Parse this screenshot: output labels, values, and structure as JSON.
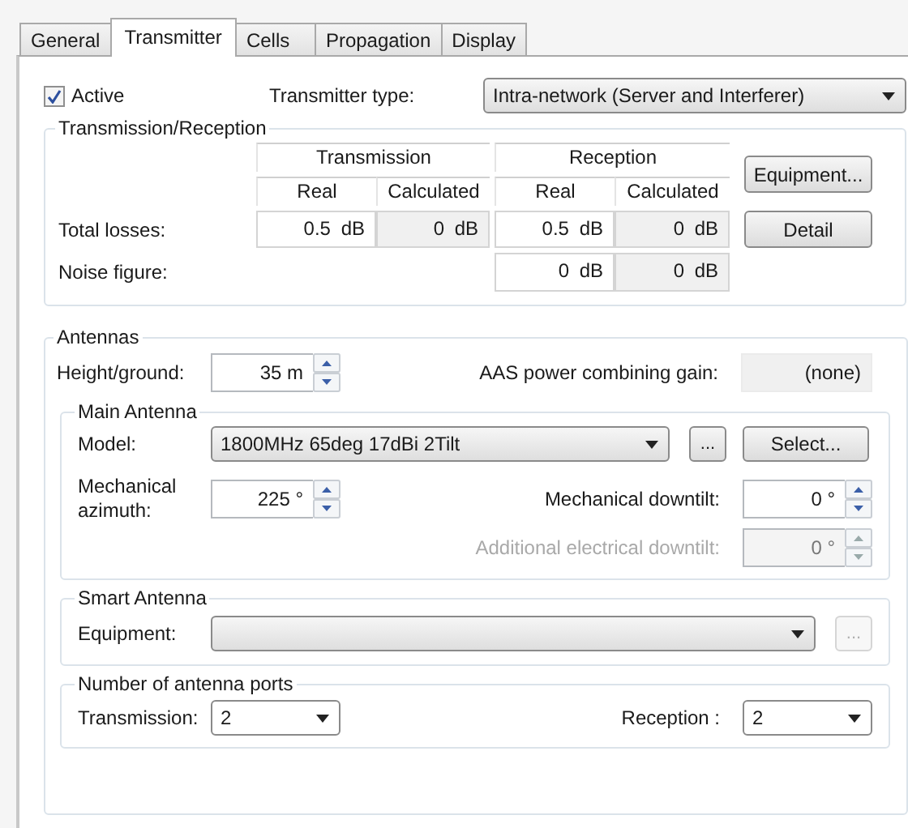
{
  "tabs": [
    {
      "label": "General",
      "selected": false
    },
    {
      "label": "Transmitter",
      "selected": true
    },
    {
      "label": "Cells",
      "selected": false
    },
    {
      "label": "Propagation",
      "selected": false
    },
    {
      "label": "Display",
      "selected": false
    }
  ],
  "active": {
    "label": "Active",
    "checked": true
  },
  "transmitter_type": {
    "label": "Transmitter type:",
    "value": "Intra-network (Server and Interferer)"
  },
  "transmission_reception": {
    "title": "Transmission/Reception",
    "column_groups": [
      {
        "title": "Transmission",
        "columns": [
          {
            "label": "Real",
            "readonly": false
          },
          {
            "label": "Calculated",
            "readonly": true
          }
        ]
      },
      {
        "title": "Reception",
        "columns": [
          {
            "label": "Real",
            "readonly": false
          },
          {
            "label": "Calculated",
            "readonly": true
          }
        ]
      }
    ],
    "rows": [
      {
        "label": "Total losses:",
        "cells": [
          "0.5 dB",
          "0 dB",
          "0.5 dB",
          "0 dB"
        ]
      },
      {
        "label": "Noise figure:",
        "cells": [
          null,
          null,
          "0 dB",
          "0 dB"
        ]
      }
    ],
    "buttons": [
      {
        "label": "Equipment..."
      },
      {
        "label": "Detail"
      }
    ]
  },
  "antennas": {
    "title": "Antennas",
    "height": {
      "label": "Height/ground:",
      "value": "35 m"
    },
    "aas_gain": {
      "label": "AAS power combining gain:",
      "value": "(none)"
    },
    "main_antenna": {
      "title": "Main Antenna",
      "model": {
        "label": "Model:",
        "value": "1800MHz 65deg 17dBi 2Tilt"
      },
      "browse_button": {
        "label": "...",
        "disabled": false
      },
      "select_button": {
        "label": "Select..."
      },
      "azimuth": {
        "label": "Mechanical azimuth:",
        "value": "225 °"
      },
      "downtilts": [
        {
          "label": "Mechanical downtilt:",
          "value": "0 °",
          "disabled": false
        },
        {
          "label": "Additional electrical downtilt:",
          "value": "0 °",
          "disabled": true
        }
      ]
    },
    "smart_antenna": {
      "title": "Smart Antenna",
      "equipment": {
        "label": "Equipment:"
      },
      "browse_button": {
        "label": "...",
        "disabled": true
      }
    },
    "antenna_ports": {
      "title": "Number of antenna ports",
      "transmission": {
        "label": "Transmission:",
        "value": "2"
      },
      "reception": {
        "label": "Reception :",
        "value": "2"
      }
    }
  }
}
